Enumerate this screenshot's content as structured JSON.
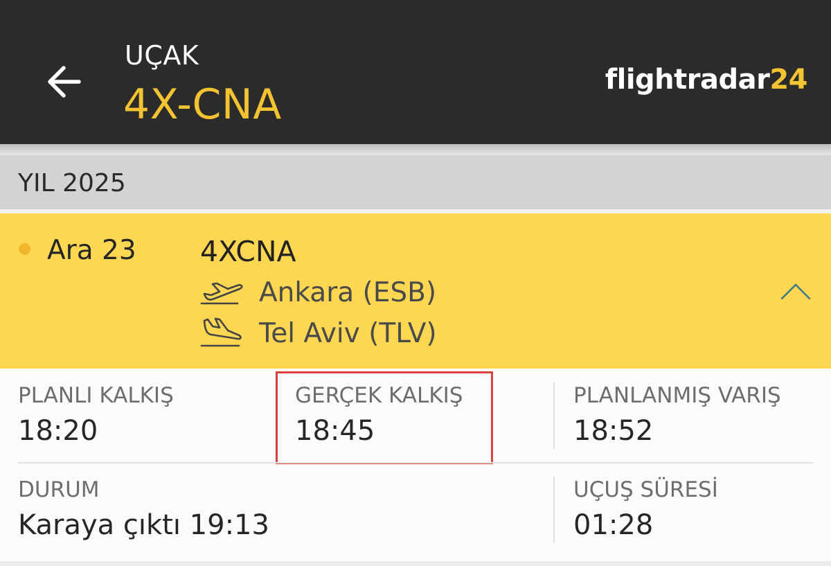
{
  "header": {
    "eyebrow": "UÇAK",
    "title": "4X-CNA",
    "brand_main": "flightradar",
    "brand_number": "24",
    "accent_color": "#f4c331",
    "background_color": "#2b2b2b",
    "back_icon": "arrow-left-icon"
  },
  "year": {
    "label": "YIL 2025"
  },
  "flight": {
    "date": "Ara 23",
    "callsign": "4XCNA",
    "origin": "Ankara (ESB)",
    "destination": "Tel Aviv (TLV)",
    "status_dot_color": "#f2b62d",
    "card_color": "#fdd652",
    "departure_icon": "plane-takeoff-icon",
    "arrival_icon": "plane-landing-icon",
    "collapse_icon": "chevron-up-icon"
  },
  "details": {
    "scheduled_departure": {
      "label": "PLANLI KALKIŞ",
      "value": "18:20"
    },
    "actual_departure": {
      "label": "GERÇEK KALKIŞ",
      "value": "18:45"
    },
    "scheduled_arrival": {
      "label": "PLANLANMIŞ VARIŞ",
      "value": "18:52"
    },
    "status": {
      "label": "DURUM",
      "value": "Karaya çıktı 19:13"
    },
    "duration": {
      "label": "UÇUŞ SÜRESİ",
      "value": "01:28"
    },
    "highlight_color": "#d8423b"
  }
}
